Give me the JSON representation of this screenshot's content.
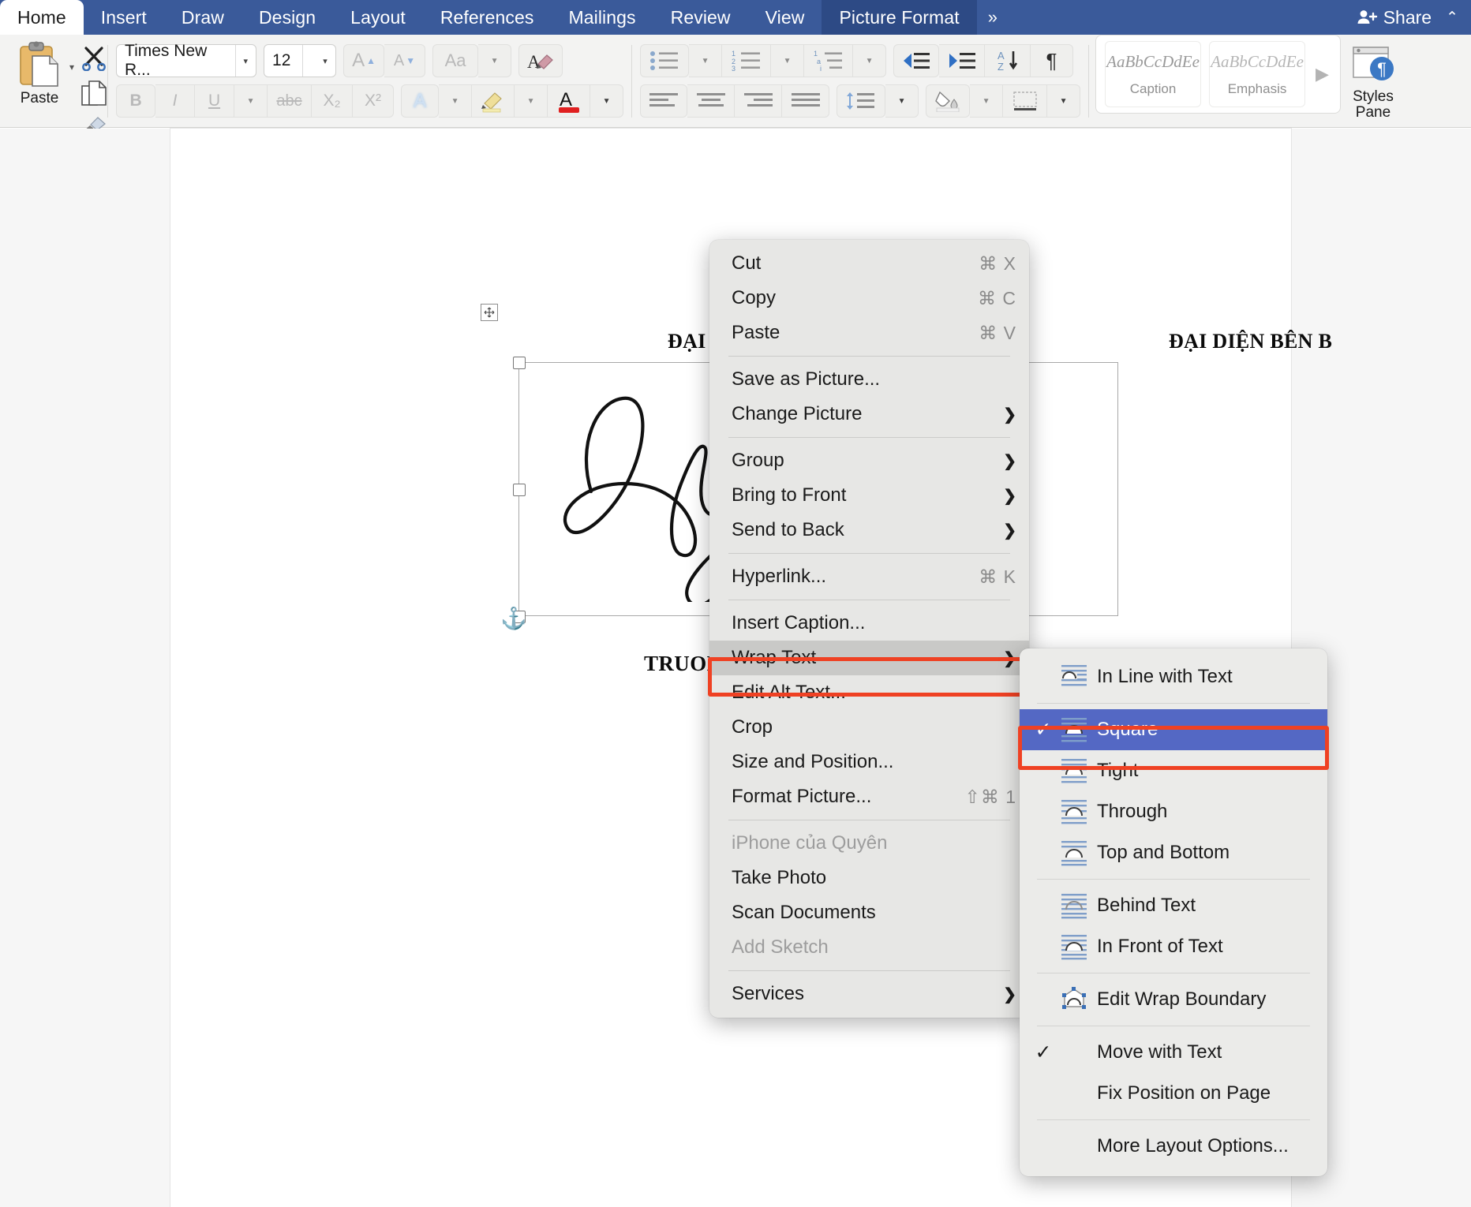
{
  "ribbon": {
    "tabs": [
      {
        "label": "Home",
        "state": "active-white"
      },
      {
        "label": "Insert",
        "state": "normal"
      },
      {
        "label": "Draw",
        "state": "normal"
      },
      {
        "label": "Design",
        "state": "normal"
      },
      {
        "label": "Layout",
        "state": "normal"
      },
      {
        "label": "References",
        "state": "normal"
      },
      {
        "label": "Mailings",
        "state": "normal"
      },
      {
        "label": "Review",
        "state": "normal"
      },
      {
        "label": "View",
        "state": "normal"
      },
      {
        "label": "Picture Format",
        "state": "active-dark"
      }
    ],
    "overflow_label": "»",
    "share_label": "Share",
    "collapse_label": "⌃",
    "accent_blue": "#3a5a9a",
    "active_tab_blue": "#2d4a85"
  },
  "clipboard": {
    "paste_label": "Paste",
    "paste_caret": "▾",
    "cut_icon": "scissors-icon",
    "copy_icon": "copy-icon",
    "format_painter_icon": "format-painter-icon"
  },
  "font_group": {
    "font_name": "Times New R...",
    "font_size": "12",
    "grow_font": "A▴",
    "shrink_font": "A▾",
    "change_case": "Aa",
    "clear_formatting": "A",
    "bold": "B",
    "italic": "I",
    "underline": "U",
    "strikethrough": "abc",
    "subscript": "X₂",
    "superscript": "X²",
    "text_effects": "A",
    "highlight": "highlighter-icon",
    "font_color": "A",
    "font_color_swatch": "#e02020",
    "caret": "▾"
  },
  "paragraph_group": {
    "bullets": "bullet-list-icon",
    "numbering": "numbered-list-icon",
    "multilevel": "multilevel-list-icon",
    "decrease_indent": "decrease-indent-icon",
    "increase_indent": "increase-indent-icon",
    "sort": "sort-icon",
    "show_marks": "¶",
    "align_left": "align-left-icon",
    "align_center": "align-center-icon",
    "align_right": "align-right-icon",
    "justify": "justify-icon",
    "line_spacing": "line-spacing-icon",
    "shading": "shading-icon",
    "borders": "borders-icon",
    "caret": "▾"
  },
  "styles": {
    "cards": [
      {
        "preview": "AaBbCcDdEe",
        "name": "Caption"
      },
      {
        "preview": "AaBbCcDdEe",
        "name": "Emphasis"
      }
    ],
    "more_arrow": "▶",
    "pane_label_line1": "Styles",
    "pane_label_line2": "Pane",
    "pane_icon": "styles-pane-icon"
  },
  "document": {
    "paragraph_mark": "✚",
    "header_left": "ĐẠI DIỆN BÊN A",
    "header_right": "ĐẠI DIỆN BÊN B",
    "signer_name": "TRUONG THI QUYEN",
    "signature_alt": "handwritten-signature-Quyen",
    "anchor_icon": "⚓",
    "rotate_icon": "↻"
  },
  "context_menu": {
    "items": [
      {
        "label": "Cut",
        "shortcut": "⌘ X",
        "arrow": false,
        "dim": false,
        "sep_after": false
      },
      {
        "label": "Copy",
        "shortcut": "⌘ C",
        "arrow": false,
        "dim": false,
        "sep_after": false
      },
      {
        "label": "Paste",
        "shortcut": "⌘ V",
        "arrow": false,
        "dim": false,
        "sep_after": true
      },
      {
        "label": "Save as Picture...",
        "shortcut": "",
        "arrow": false,
        "dim": false,
        "sep_after": false
      },
      {
        "label": "Change Picture",
        "shortcut": "",
        "arrow": true,
        "dim": false,
        "sep_after": true
      },
      {
        "label": "Group",
        "shortcut": "",
        "arrow": true,
        "dim": false,
        "sep_after": false
      },
      {
        "label": "Bring to Front",
        "shortcut": "",
        "arrow": true,
        "dim": false,
        "sep_after": false
      },
      {
        "label": "Send to Back",
        "shortcut": "",
        "arrow": true,
        "dim": false,
        "sep_after": true
      },
      {
        "label": "Hyperlink...",
        "shortcut": "⌘ K",
        "arrow": false,
        "dim": false,
        "sep_after": true
      },
      {
        "label": "Insert Caption...",
        "shortcut": "",
        "arrow": false,
        "dim": false,
        "sep_after": false
      },
      {
        "label": "Wrap Text",
        "shortcut": "",
        "arrow": true,
        "dim": false,
        "sep_after": false,
        "selected": true
      },
      {
        "label": "Edit Alt Text...",
        "shortcut": "",
        "arrow": false,
        "dim": false,
        "sep_after": false
      },
      {
        "label": "Crop",
        "shortcut": "",
        "arrow": false,
        "dim": false,
        "sep_after": false
      },
      {
        "label": "Size and Position...",
        "shortcut": "",
        "arrow": false,
        "dim": false,
        "sep_after": false
      },
      {
        "label": "Format Picture...",
        "shortcut": "⇧⌘ 1",
        "arrow": false,
        "dim": false,
        "sep_after": true
      },
      {
        "label": "iPhone của Quyên",
        "shortcut": "",
        "arrow": false,
        "dim": true,
        "sep_after": false
      },
      {
        "label": "Take Photo",
        "shortcut": "",
        "arrow": false,
        "dim": false,
        "sep_after": false
      },
      {
        "label": "Scan Documents",
        "shortcut": "",
        "arrow": false,
        "dim": false,
        "sep_after": false
      },
      {
        "label": "Add Sketch",
        "shortcut": "",
        "arrow": false,
        "dim": true,
        "sep_after": true
      },
      {
        "label": "Services",
        "shortcut": "",
        "arrow": true,
        "dim": false,
        "sep_after": false
      }
    ],
    "highlight_color": "#ef4123"
  },
  "wrap_submenu": {
    "items": [
      {
        "label": "In Line with Text",
        "icon": "wrap-inline-icon",
        "checked": false,
        "highlighted": false,
        "sep_after": true
      },
      {
        "label": "Square",
        "icon": "wrap-square-icon",
        "checked": true,
        "highlighted": true,
        "sep_after": false
      },
      {
        "label": "Tight",
        "icon": "wrap-tight-icon",
        "checked": false,
        "highlighted": false,
        "sep_after": false
      },
      {
        "label": "Through",
        "icon": "wrap-through-icon",
        "checked": false,
        "highlighted": false,
        "sep_after": false
      },
      {
        "label": "Top and Bottom",
        "icon": "wrap-topbottom-icon",
        "checked": false,
        "highlighted": false,
        "sep_after": true
      },
      {
        "label": "Behind Text",
        "icon": "wrap-behind-icon",
        "checked": false,
        "highlighted": false,
        "sep_after": false
      },
      {
        "label": "In Front of Text",
        "icon": "wrap-infront-icon",
        "checked": false,
        "highlighted": false,
        "sep_after": true
      },
      {
        "label": "Edit Wrap Boundary",
        "icon": "edit-wrap-boundary-icon",
        "checked": false,
        "highlighted": false,
        "sep_after": true
      },
      {
        "label": "Move with Text",
        "icon": "",
        "checked": true,
        "highlighted": false,
        "sep_after": false
      },
      {
        "label": "Fix Position on Page",
        "icon": "",
        "checked": false,
        "highlighted": false,
        "sep_after": true
      },
      {
        "label": "More Layout Options...",
        "icon": "",
        "checked": false,
        "highlighted": false,
        "sep_after": false
      }
    ],
    "selected_bg": "#5468c4",
    "highlight_color": "#ef4123",
    "check_glyph": "✓"
  }
}
